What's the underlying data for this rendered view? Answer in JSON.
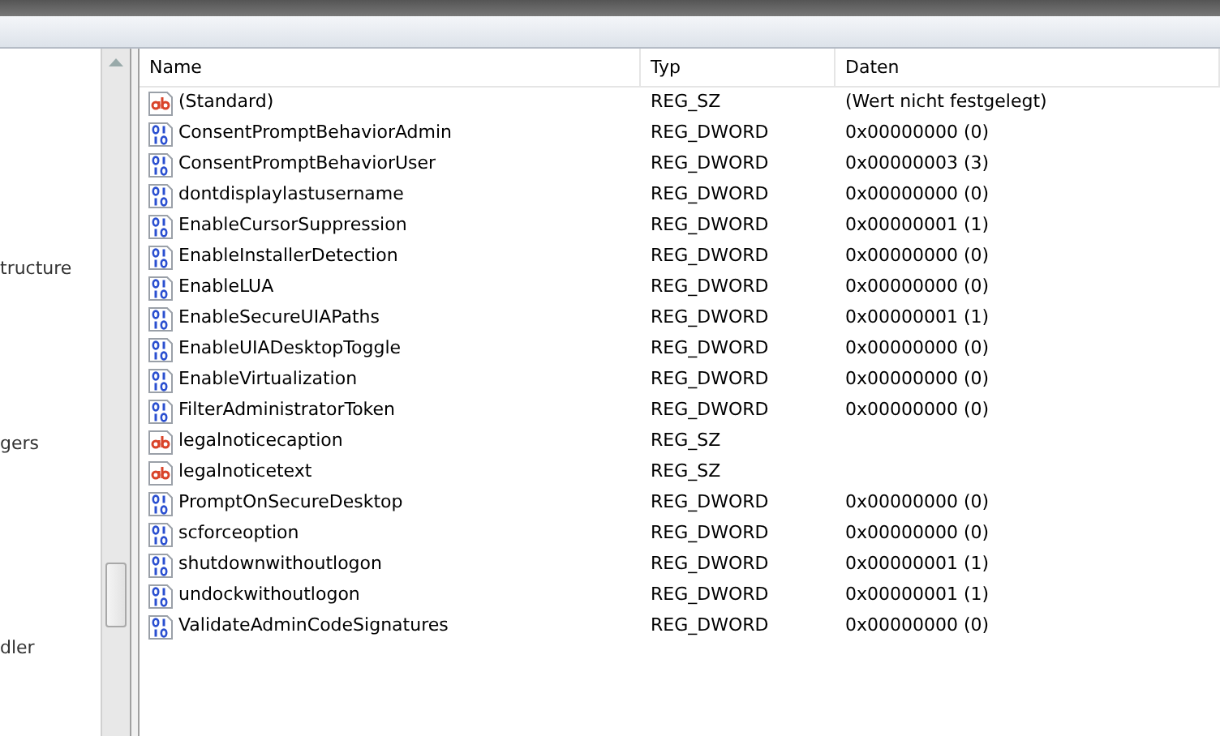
{
  "tree": {
    "items": [
      {
        "label": "tructure"
      },
      {
        "label": "gers"
      },
      {
        "label": "dler"
      }
    ]
  },
  "table": {
    "columns": [
      "Name",
      "Typ",
      "Daten"
    ],
    "rows": [
      {
        "kind": "string",
        "name": "(Standard)",
        "type": "REG_SZ",
        "data": "(Wert nicht festgelegt)"
      },
      {
        "kind": "binary",
        "name": "ConsentPromptBehaviorAdmin",
        "type": "REG_DWORD",
        "data": "0x00000000 (0)"
      },
      {
        "kind": "binary",
        "name": "ConsentPromptBehaviorUser",
        "type": "REG_DWORD",
        "data": "0x00000003 (3)"
      },
      {
        "kind": "binary",
        "name": "dontdisplaylastusername",
        "type": "REG_DWORD",
        "data": "0x00000000 (0)"
      },
      {
        "kind": "binary",
        "name": "EnableCursorSuppression",
        "type": "REG_DWORD",
        "data": "0x00000001 (1)"
      },
      {
        "kind": "binary",
        "name": "EnableInstallerDetection",
        "type": "REG_DWORD",
        "data": "0x00000000 (0)"
      },
      {
        "kind": "binary",
        "name": "EnableLUA",
        "type": "REG_DWORD",
        "data": "0x00000000 (0)"
      },
      {
        "kind": "binary",
        "name": "EnableSecureUIAPaths",
        "type": "REG_DWORD",
        "data": "0x00000001 (1)"
      },
      {
        "kind": "binary",
        "name": "EnableUIADesktopToggle",
        "type": "REG_DWORD",
        "data": "0x00000000 (0)"
      },
      {
        "kind": "binary",
        "name": "EnableVirtualization",
        "type": "REG_DWORD",
        "data": "0x00000000 (0)"
      },
      {
        "kind": "binary",
        "name": "FilterAdministratorToken",
        "type": "REG_DWORD",
        "data": "0x00000000 (0)"
      },
      {
        "kind": "string",
        "name": "legalnoticecaption",
        "type": "REG_SZ"
      },
      {
        "kind": "string",
        "name": "legalnoticetext",
        "type": "REG_SZ"
      },
      {
        "kind": "binary",
        "name": "PromptOnSecureDesktop",
        "type": "REG_DWORD",
        "data": "0x00000000 (0)"
      },
      {
        "kind": "binary",
        "name": "scforceoption",
        "type": "REG_DWORD",
        "data": "0x00000000 (0)"
      },
      {
        "kind": "binary",
        "name": "shutdownwithoutlogon",
        "type": "REG_DWORD",
        "data": "0x00000001 (1)"
      },
      {
        "kind": "binary",
        "name": "undockwithoutlogon",
        "type": "REG_DWORD",
        "data": "0x00000001 (1)"
      },
      {
        "kind": "binary",
        "name": "ValidateAdminCodeSignatures",
        "type": "REG_DWORD",
        "data": "0x00000000 (0)"
      }
    ]
  }
}
